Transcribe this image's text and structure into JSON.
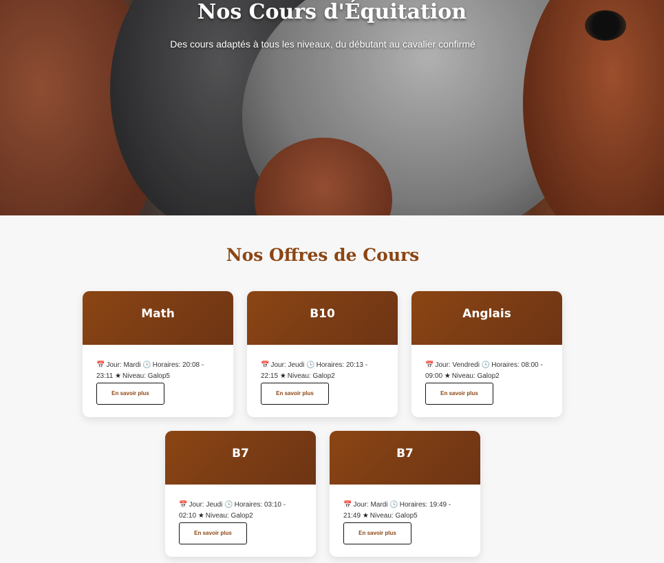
{
  "hero": {
    "title": "Nos Cours d'Équitation",
    "subtitle": "Des cours adaptés à tous les niveaux, du débutant au cavalier confirmé"
  },
  "section": {
    "title": "Nos Offres de Cours"
  },
  "labels": {
    "day": "Jour:",
    "hours": "Horaires:",
    "level": "Niveau:",
    "button": "En savoir plus"
  },
  "courses": [
    {
      "name": "Math",
      "day": "Mardi",
      "hours": "20:08 - 23:11",
      "level": "Galop5"
    },
    {
      "name": "B10",
      "day": "Jeudi",
      "hours": "20:13 - 22:15",
      "level": "Galop2"
    },
    {
      "name": "Anglais",
      "day": "Vendredi",
      "hours": "08:00 - 09:00",
      "level": "Galop2"
    },
    {
      "name": "B7",
      "day": "Jeudi",
      "hours": "03:10 - 02:10",
      "level": "Galop2"
    },
    {
      "name": "B7",
      "day": "Mardi",
      "hours": "19:49 - 21:49",
      "level": "Galop5"
    }
  ],
  "icons": {
    "calendar": "calendar-icon",
    "clock": "clock-icon",
    "star": "star-icon"
  },
  "colors": {
    "accent": "#8b4513",
    "page_background": "#f7f7f7",
    "card_background": "#ffffff"
  }
}
